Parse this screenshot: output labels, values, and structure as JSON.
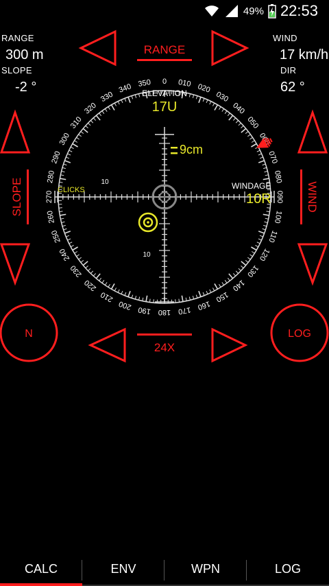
{
  "status_bar": {
    "battery_percent": "49%",
    "time": "22:53"
  },
  "left_readouts": {
    "range_label": "RANGE",
    "range_value": "300 m",
    "slope_label": "SLOPE",
    "slope_value": "-2 °"
  },
  "right_readouts": {
    "wind_label": "WIND",
    "wind_value": "17 km/h",
    "dir_label": "DIR",
    "dir_value": "62 °"
  },
  "controls": {
    "range_label": "RANGE",
    "slope_label": "SLOPE",
    "wind_label": "WIND",
    "zoom_label": "24X",
    "north_label": "N",
    "log_label": "LOG"
  },
  "reticle": {
    "elevation_label": "ELEVATION",
    "elevation_value": "17U",
    "offset_value": "9cm",
    "clicks_label": "CLICKS",
    "windage_label": "WINDAGE",
    "windage_value": "10R",
    "h_scale_label": "10",
    "v_scale_label": "10",
    "dial_numbers": [
      "0",
      "010",
      "020",
      "030",
      "040",
      "050",
      "060",
      "070",
      "080",
      "090",
      "100",
      "110",
      "120",
      "130",
      "140",
      "150",
      "160",
      "170",
      "180",
      "190",
      "200",
      "210",
      "220",
      "230",
      "240",
      "250",
      "260",
      "270",
      "280",
      "290",
      "300",
      "310",
      "320",
      "330",
      "340",
      "350"
    ],
    "wind_direction_deg": 62
  },
  "tabs": [
    {
      "label": "CALC"
    },
    {
      "label": "ENV"
    },
    {
      "label": "WPN"
    },
    {
      "label": "LOG"
    }
  ],
  "active_tab": "CALC",
  "colors": {
    "accent_red": "#ff1e1e",
    "reticle_yellow": "#e8e82a",
    "background": "#000000"
  }
}
